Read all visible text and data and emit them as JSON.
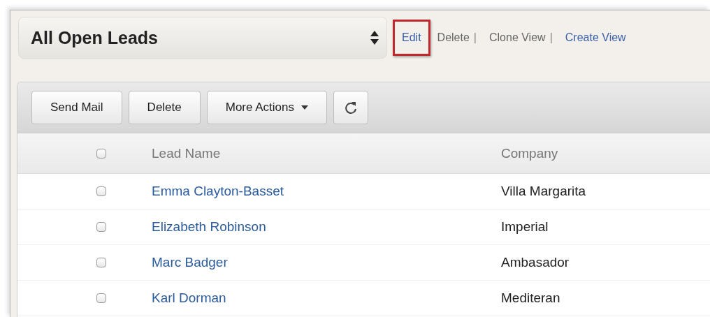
{
  "view_selector": {
    "value": "All Open Leads"
  },
  "view_links": [
    {
      "label": "Edit",
      "kind": "link",
      "highlighted": true
    },
    {
      "label": "Delete",
      "kind": "plain",
      "highlighted": false,
      "separator": "|"
    },
    {
      "label": "Clone View",
      "kind": "plain",
      "highlighted": false,
      "separator": "|"
    },
    {
      "label": "Create View",
      "kind": "link",
      "highlighted": false
    }
  ],
  "toolbar": [
    {
      "label": "Send Mail",
      "kind": "button"
    },
    {
      "label": "Delete",
      "kind": "button"
    },
    {
      "label": "More Actions",
      "kind": "dropdown"
    },
    {
      "kind": "refresh"
    }
  ],
  "table": {
    "select_all": {
      "checked": false
    },
    "columns": [
      "Lead Name",
      "Company"
    ],
    "rows": [
      {
        "checked": false,
        "lead_name": "Emma Clayton-Basset",
        "company": "Villa Margarita"
      },
      {
        "checked": false,
        "lead_name": "Elizabeth Robinson",
        "company": "Imperial"
      },
      {
        "checked": false,
        "lead_name": "Marc Badger",
        "company": "Ambasador"
      },
      {
        "checked": false,
        "lead_name": "Karl Dorman",
        "company": "Mediteran"
      }
    ]
  }
}
